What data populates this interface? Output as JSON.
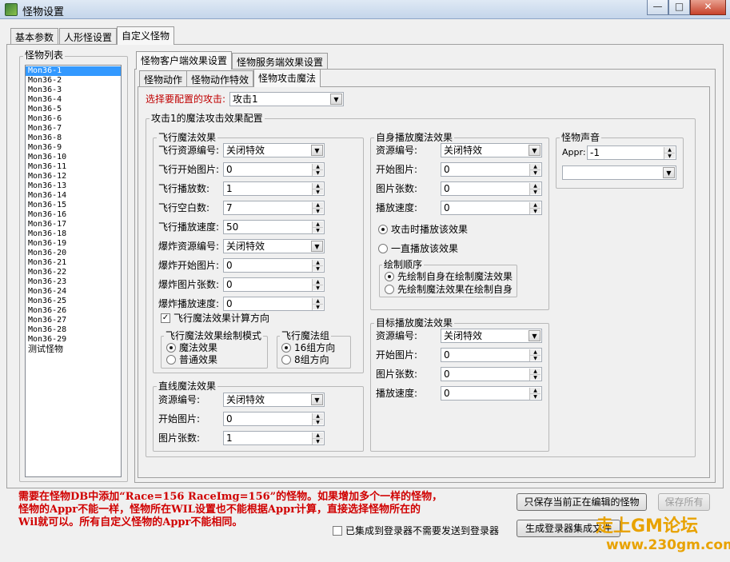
{
  "window": {
    "title": "怪物设置",
    "min_label": "—",
    "max_label": "□",
    "close_label": "✕"
  },
  "main_tabs": [
    "基本参数",
    "人形怪设置",
    "自定义怪物"
  ],
  "monster_list": {
    "title": "怪物列表",
    "items": [
      "Mon36-1",
      "Mon36-2",
      "Mon36-3",
      "Mon36-4",
      "Mon36-5",
      "Mon36-6",
      "Mon36-7",
      "Mon36-8",
      "Mon36-9",
      "Mon36-10",
      "Mon36-11",
      "Mon36-12",
      "Mon36-13",
      "Mon36-14",
      "Mon36-15",
      "Mon36-16",
      "Mon36-17",
      "Mon36-18",
      "Mon36-19",
      "Mon36-20",
      "Mon36-21",
      "Mon36-22",
      "Mon36-23",
      "Mon36-24",
      "Mon36-25",
      "Mon36-26",
      "Mon36-27",
      "Mon36-28",
      "Mon36-29",
      "测试怪物"
    ],
    "selected_index": 0
  },
  "effect_tabs": [
    "怪物客户端效果设置",
    "怪物服务端效果设置"
  ],
  "sub_tabs": [
    "怪物动作",
    "怪物动作特效",
    "怪物攻击魔法"
  ],
  "attack": {
    "select_label": "选择要配置的攻击:",
    "select_value": "攻击1",
    "group_title": "攻击1的魔法攻击效果配置"
  },
  "fly": {
    "title": "飞行魔法效果",
    "rows": [
      {
        "label": "飞行资源编号:",
        "type": "combo",
        "value": "关闭特效"
      },
      {
        "label": "飞行开始图片:",
        "type": "spin",
        "value": "0"
      },
      {
        "label": "飞行播放数:",
        "type": "spin",
        "value": "1"
      },
      {
        "label": "飞行空白数:",
        "type": "spin",
        "value": "7"
      },
      {
        "label": "飞行播放速度:",
        "type": "spin",
        "value": "50"
      },
      {
        "label": "爆炸资源编号:",
        "type": "combo",
        "value": "关闭特效"
      },
      {
        "label": "爆炸开始图片:",
        "type": "spin",
        "value": "0"
      },
      {
        "label": "爆炸图片张数:",
        "type": "spin",
        "value": "0"
      },
      {
        "label": "爆炸播放速度:",
        "type": "spin",
        "value": "0"
      }
    ],
    "calc_direction": "飞行魔法效果计算方向",
    "draw_mode_title": "飞行魔法效果绘制模式",
    "draw_mode_options": [
      "魔法效果",
      "普通效果"
    ],
    "group_title": "飞行魔法组",
    "group_options": [
      "16组方向",
      "8组方向"
    ]
  },
  "line": {
    "title": "直线魔法效果",
    "rows": [
      {
        "label": "资源编号:",
        "type": "combo",
        "value": "关闭特效"
      },
      {
        "label": "开始图片:",
        "type": "spin",
        "value": "0"
      },
      {
        "label": "图片张数:",
        "type": "spin",
        "value": "1"
      }
    ]
  },
  "self": {
    "title": "自身播放魔法效果",
    "rows": [
      {
        "label": "资源编号:",
        "type": "combo",
        "value": "关闭特效"
      },
      {
        "label": "开始图片:",
        "type": "spin",
        "value": "0"
      },
      {
        "label": "图片张数:",
        "type": "spin",
        "value": "0"
      },
      {
        "label": "播放速度:",
        "type": "spin",
        "value": "0"
      }
    ],
    "play_options": [
      "攻击时播放该效果",
      "一直播放该效果"
    ],
    "order_title": "绘制顺序",
    "order_options": [
      "先绘制自身在绘制魔法效果",
      "先绘制魔法效果在绘制自身"
    ]
  },
  "target": {
    "title": "目标播放魔法效果",
    "rows": [
      {
        "label": "资源编号:",
        "type": "combo",
        "value": "关闭特效"
      },
      {
        "label": "开始图片:",
        "type": "spin",
        "value": "0"
      },
      {
        "label": "图片张数:",
        "type": "spin",
        "value": "0"
      },
      {
        "label": "播放速度:",
        "type": "spin",
        "value": "0"
      }
    ]
  },
  "sound": {
    "title": "怪物声音",
    "appr_label": "Appr:",
    "appr_value": "-1",
    "combo_value": ""
  },
  "notes": [
    "需要在怪物DB中添加“Race=156 RaceImg=156”的怪物。如果增加多个一样的怪物，",
    "怪物的Appr不能一样，怪物所在WIL设置也不能根据Appr计算，直接选择怪物所在的",
    "Wil就可以。所有自定义怪物的Appr不能相同。"
  ],
  "buttons": {
    "save_current": "只保存当前正在编辑的怪物",
    "save_all": "保存所有",
    "generate": "生成登录器集成文件",
    "integrated": "已集成到登录器不需要发送到登录器"
  },
  "watermark": {
    "text": "走上GM论坛",
    "url": "www.230gm.com"
  },
  "colors": {
    "note_red": "#d00000",
    "label_red": "#c00000",
    "select_blue": "#3399ff"
  }
}
